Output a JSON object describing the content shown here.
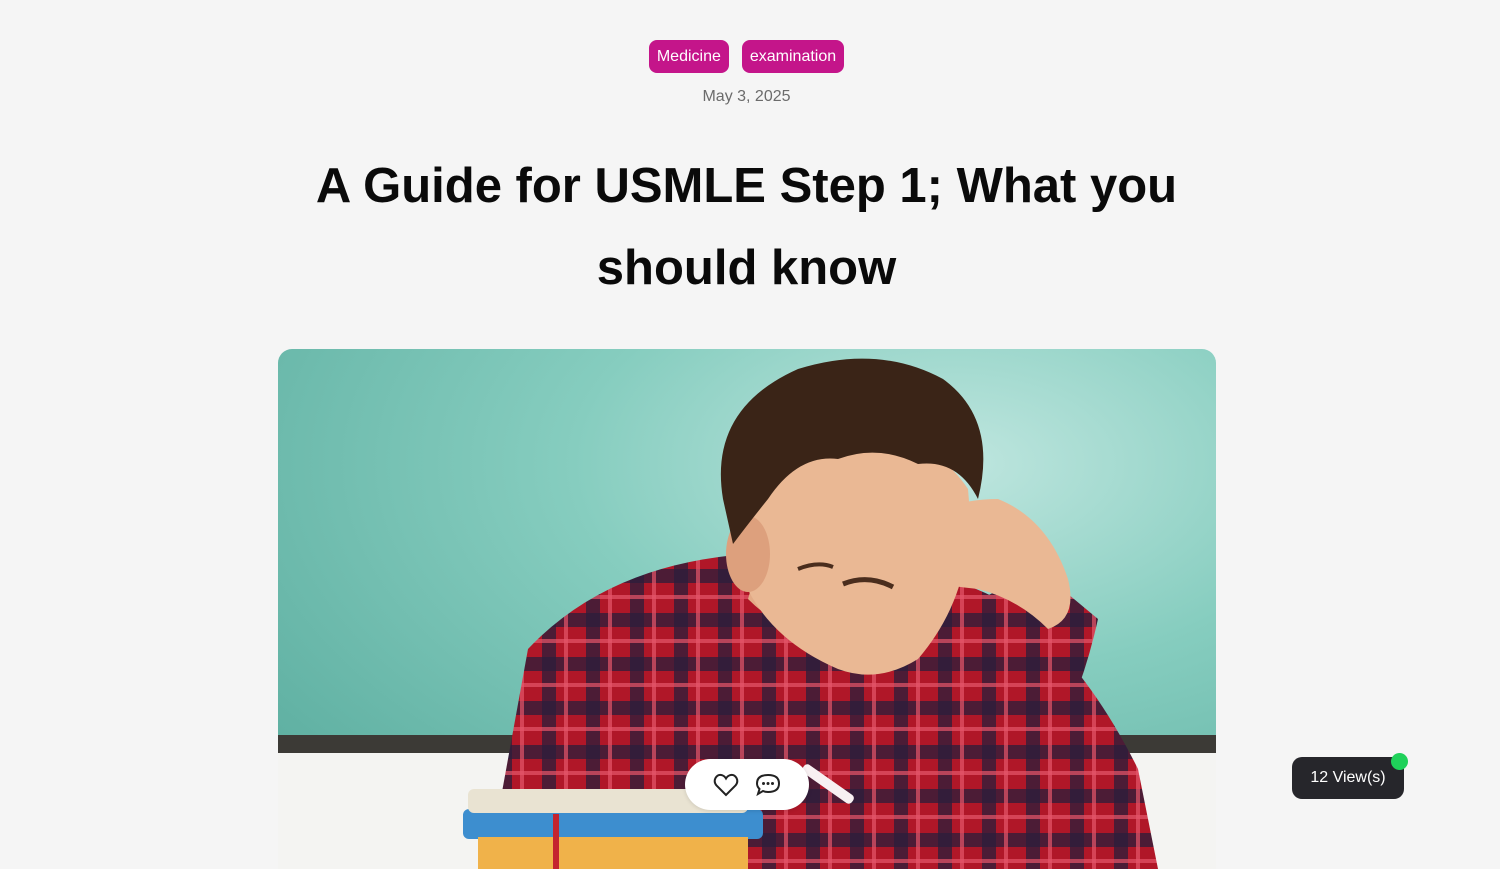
{
  "colors": {
    "tag_bg": "#c4158a",
    "online_dot": "#1fd15a",
    "views_bg": "#26262b"
  },
  "tags": [
    "Medicine",
    "examination"
  ],
  "date": "May 3, 2025",
  "title": "A Guide for USMLE Step 1; What you should know",
  "hero_image": {
    "icon": "student-studying-photo"
  },
  "reactions": {
    "like_icon": "heart-icon",
    "comment_icon": "comment-bubble-icon"
  },
  "views": {
    "label": "12 View(s)"
  }
}
